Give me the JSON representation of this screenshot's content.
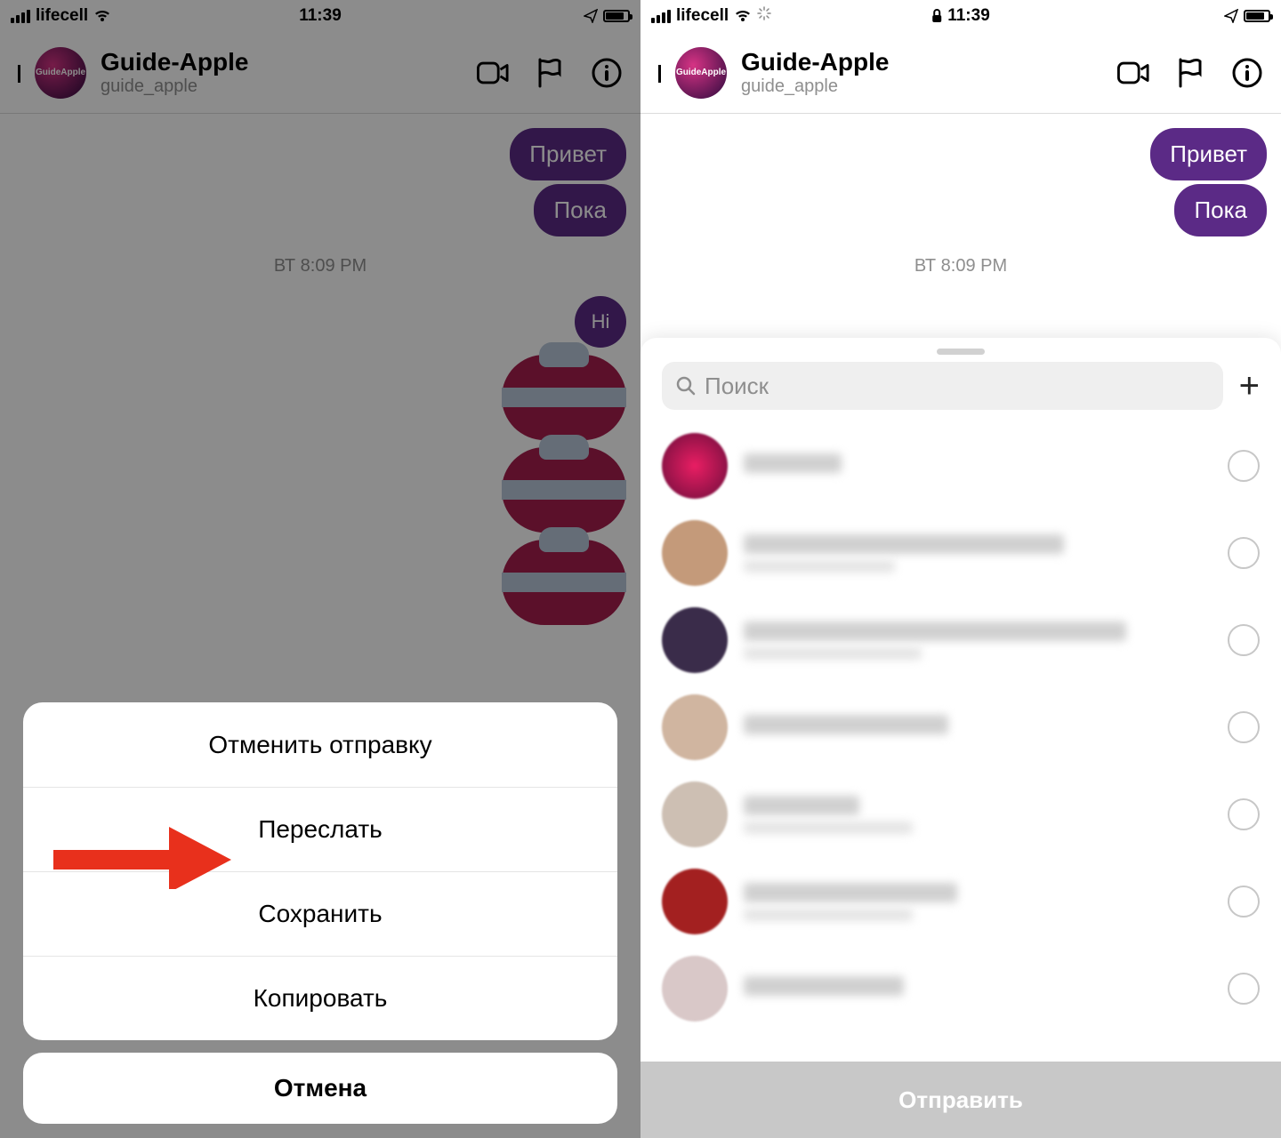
{
  "status": {
    "carrier": "lifecell",
    "time": "11:39"
  },
  "chat": {
    "title": "Guide-Apple",
    "username": "guide_apple",
    "msg1": "Привет",
    "msg2": "Пока",
    "timestamp": "ВТ 8:09 PM",
    "msg3": "Hi"
  },
  "sheet": {
    "unsend": "Отменить отправку",
    "forward": "Переслать",
    "save": "Сохранить",
    "copy": "Копировать",
    "cancel": "Отмена"
  },
  "share": {
    "search_placeholder": "Поиск",
    "send": "Отправить",
    "contacts": [
      {
        "w1": "110px",
        "w2": "0"
      },
      {
        "w1": "360px",
        "w2": "170px"
      },
      {
        "w1": "430px",
        "w2": "200px"
      },
      {
        "w1": "230px",
        "w2": "0"
      },
      {
        "w1": "130px",
        "w2": "190px"
      },
      {
        "w1": "240px",
        "w2": "190px"
      },
      {
        "w1": "180px",
        "w2": "0"
      }
    ]
  }
}
